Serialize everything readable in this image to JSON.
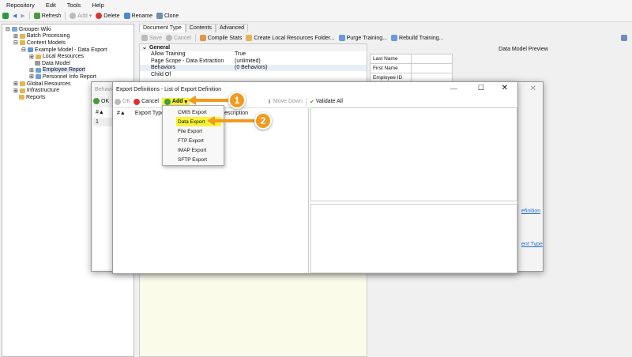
{
  "menu": [
    "Repository",
    "Edit",
    "Tools",
    "Help"
  ],
  "toolbar": {
    "refresh": "Refresh",
    "add": "Add",
    "delete": "Delete",
    "rename": "Rename",
    "clone": "Clone"
  },
  "tree": [
    "Grooper Wiki",
    "Batch Processing",
    "Content Models",
    "Example Model - Data Export",
    "Local Resources",
    "Data Model",
    "Employee Report",
    "Personnel Info Report",
    "Global Resources",
    "Infrastructure",
    "Reports"
  ],
  "tabs": [
    "Document Type",
    "Contents",
    "Advanced"
  ],
  "doc_toolbar": {
    "save": "Save",
    "cancel": "Cancel",
    "compile": "Compile Stats",
    "create": "Create Local Resources Folder...",
    "purge": "Purge Training...",
    "rebuild": "Rebuild Training..."
  },
  "props": {
    "section": "General",
    "rows": [
      [
        "Allow Training",
        "True"
      ],
      [
        "Page Scope - Data Extraction",
        "(unlimited)"
      ],
      [
        "Behaviors",
        "(0 Behaviors)"
      ],
      [
        "Child Of",
        ""
      ]
    ]
  },
  "preview": {
    "title": "Data Model Preview",
    "fields": [
      "Last Name",
      "First Name",
      "Employee ID"
    ]
  },
  "behaviors": {
    "title": "Behavio",
    "ok": "OK",
    "col": "#▲",
    "row": "1",
    "link1": "efinition",
    "link2": "ent Type"
  },
  "export": {
    "title": "Export Definitions - List of Export Definition",
    "ok": "OK",
    "cancel": "Cancel",
    "add": "Add",
    "move_down": "Move Down",
    "validate": "Validate All",
    "cols": [
      "#▲",
      "Export Type",
      "escription"
    ]
  },
  "add_menu": [
    "CMIS Export",
    "Data Export",
    "File Export",
    "FTP Export",
    "IMAP Export",
    "SFTP Export"
  ],
  "callouts": [
    "1",
    "2"
  ]
}
